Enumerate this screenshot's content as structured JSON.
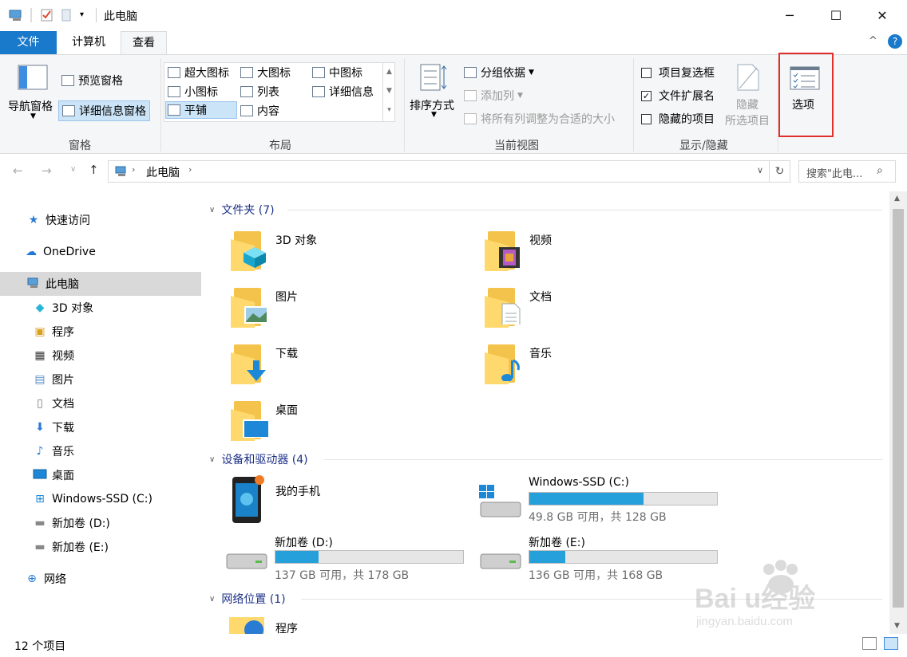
{
  "window": {
    "title": "此电脑",
    "minimize": "─",
    "maximize": "☐",
    "close": "✕"
  },
  "tabs": {
    "file": "文件",
    "computer": "计算机",
    "view": "查看"
  },
  "ribbon": {
    "pane": {
      "nav_pane": "导航窗格",
      "preview_pane": "预览窗格",
      "details_pane": "详细信息窗格",
      "label": "窗格"
    },
    "layout": {
      "extra_large": "超大图标",
      "large": "大图标",
      "medium": "中图标",
      "small": "小图标",
      "list": "列表",
      "details": "详细信息",
      "tiles": "平铺",
      "content": "内容",
      "label": "布局"
    },
    "current_view": {
      "sort_by": "排序方式",
      "group_by": "分组依据",
      "add_columns": "添加列",
      "size_columns": "将所有列调整为合适的大小",
      "label": "当前视图"
    },
    "show_hide": {
      "item_checkboxes": "项目复选框",
      "file_extensions": "文件扩展名",
      "hidden_items": "隐藏的项目",
      "hide_selected_1": "隐藏",
      "hide_selected_2": "所选项目",
      "label": "显示/隐藏"
    },
    "options": {
      "label": "选项"
    },
    "highlight_color": "#e0302c"
  },
  "address": {
    "path": "此电脑",
    "search_placeholder": "搜索\"此电..."
  },
  "nav": {
    "quick_access": "快速访问",
    "onedrive": "OneDrive",
    "this_pc": "此电脑",
    "items": [
      "3D 对象",
      "程序",
      "视频",
      "图片",
      "文档",
      "下载",
      "音乐",
      "桌面",
      "Windows-SSD (C:)",
      "新加卷 (D:)",
      "新加卷 (E:)"
    ],
    "network": "网络"
  },
  "content": {
    "folders_header": "文件夹 (7)",
    "folders": [
      "3D 对象",
      "视频",
      "图片",
      "文档",
      "下载",
      "音乐",
      "桌面"
    ],
    "devices_header": "设备和驱动器 (4)",
    "phone": "我的手机",
    "drives": [
      {
        "name": "Windows-SSD (C:)",
        "info": "49.8 GB 可用，共 128 GB",
        "used_fraction": 0.61
      },
      {
        "name": "新加卷 (D:)",
        "info": "137 GB 可用，共 178 GB",
        "used_fraction": 0.23
      },
      {
        "name": "新加卷 (E:)",
        "info": "136 GB 可用，共 168 GB",
        "used_fraction": 0.19
      }
    ],
    "network_header": "网络位置 (1)",
    "network_item": "程序"
  },
  "status": {
    "count": "12 个项目"
  },
  "watermark": "Baidu经验 jingyan.baidu.com"
}
